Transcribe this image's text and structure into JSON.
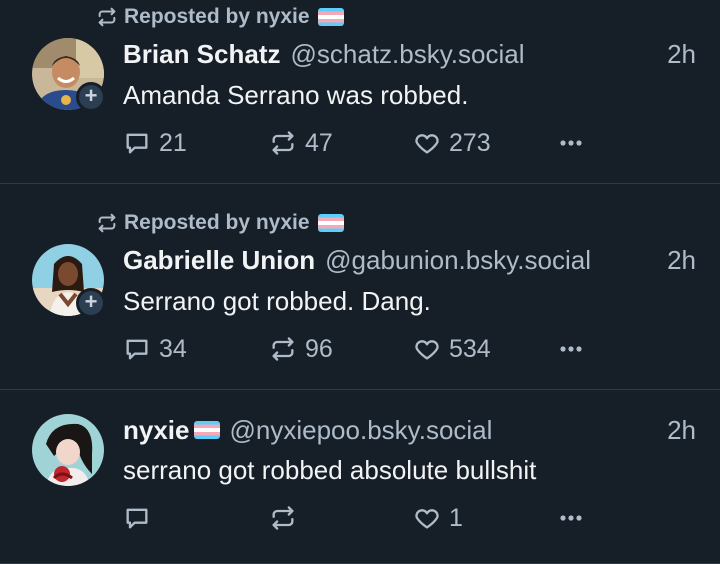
{
  "posts": [
    {
      "repost_label": "Reposted by nyxie",
      "display_name": "Brian Schatz",
      "handle": "@schatz.bsky.social",
      "time": "2h",
      "text": "Amanda Serrano was robbed.",
      "replies": "21",
      "reposts": "47",
      "likes": "273"
    },
    {
      "repost_label": "Reposted by nyxie",
      "display_name": "Gabrielle Union",
      "handle": "@gabunion.bsky.social",
      "time": "2h",
      "text": "Serrano got robbed. Dang.",
      "replies": "34",
      "reposts": "96",
      "likes": "534"
    },
    {
      "display_name": "nyxie",
      "handle": "@nyxiepoo.bsky.social",
      "time": "2h",
      "text": "serrano got robbed absolute bullshit",
      "replies": "",
      "reposts": "",
      "likes": "1"
    }
  ],
  "icons": {
    "repost": "repost-icon",
    "reply": "reply-icon",
    "like": "heart-icon",
    "more": "more-icon",
    "follow": "plus-icon",
    "flag": "transgender-flag-emoji"
  },
  "colors": {
    "background": "#161e27",
    "muted_text": "#aebbc9",
    "primary_text": "#f1f3f5",
    "divider": "#2e3a48"
  }
}
